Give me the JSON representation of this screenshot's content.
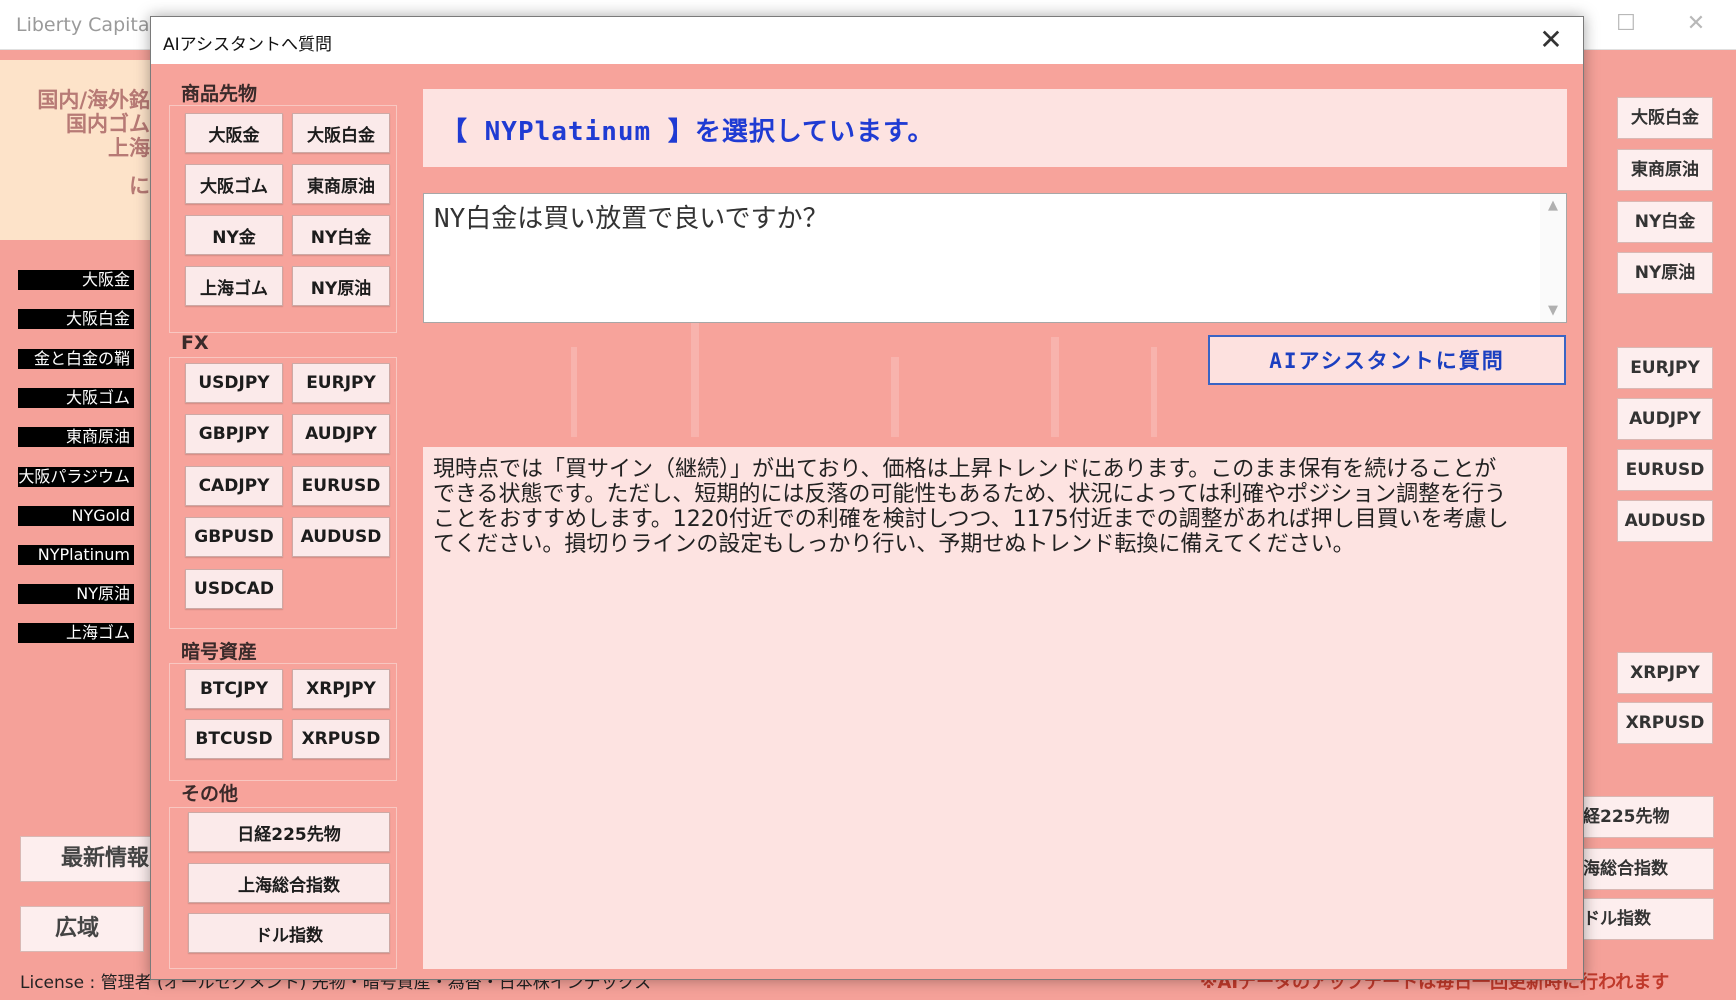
{
  "background_window": {
    "title": "Liberty Capital W",
    "top_left_lines": [
      "国内/海外銘",
      "国内ゴム",
      "上海",
      "に"
    ],
    "left_labels": [
      "大阪金",
      "大阪白金",
      "金と白金の鞘",
      "大阪ゴム",
      "東商原油",
      "大阪パラジウム",
      "NYGold",
      "NYPlatinum",
      "NY原油",
      "上海ゴム"
    ],
    "left_buttons": [
      "最新情報",
      "広域"
    ],
    "right_buttons_a": [
      "大阪白金",
      "東商原油",
      "NY白金",
      "NY原油"
    ],
    "right_buttons_b": [
      "EURJPY",
      "AUDJPY",
      "EURUSD",
      "AUDUSD"
    ],
    "right_buttons_c": [
      "XRPJPY",
      "XRPUSD"
    ],
    "right_buttons_d": [
      "経225先物",
      "海総合指数",
      "ドル指数"
    ],
    "license_text": "License : 管理者 (オールセグメント) 先物・暗号資産・為替・日本株インデックス",
    "status_text": "※AIデータのアップデートは毎日一回更新時に行われます"
  },
  "dialog": {
    "title": "AIアシスタントへ質問",
    "close_icon": "close-icon",
    "sections": {
      "commodities": {
        "label": "商品先物",
        "buttons": [
          "大阪金",
          "大阪白金",
          "大阪ゴム",
          "東商原油",
          "NY金",
          "NY白金",
          "上海ゴム",
          "NY原油"
        ]
      },
      "fx": {
        "label": "FX",
        "buttons": [
          "USDJPY",
          "EURJPY",
          "GBPJPY",
          "AUDJPY",
          "CADJPY",
          "EURUSD",
          "GBPUSD",
          "AUDUSD",
          "USDCAD"
        ]
      },
      "crypto": {
        "label": "暗号資産",
        "buttons": [
          "BTCJPY",
          "XRPJPY",
          "BTCUSD",
          "XRPUSD"
        ]
      },
      "other": {
        "label": "その他",
        "buttons": [
          "日経225先物",
          "上海総合指数",
          "ドル指数"
        ]
      }
    },
    "selection_text": "【 NYPlatinum 】を選択しています。",
    "question_text": "NY白金は買い放置で良いですか？",
    "ask_button_label": "AIアシスタントに質問",
    "answer_text": "現時点では「買サイン（継続）」が出ており、価格は上昇トレンドにあります。このまま保有を続けることができる状態です。ただし、短期的には反落の可能性もあるため、状況によっては利確やポジション調整を行うことをおすすめします。1220付近での利確を検討しつつ、1175付近までの調整があれば押し目買いを考慮してください。損切りラインの設定もしっかり行い、予期せぬトレンド転換に備えてください。"
  }
}
